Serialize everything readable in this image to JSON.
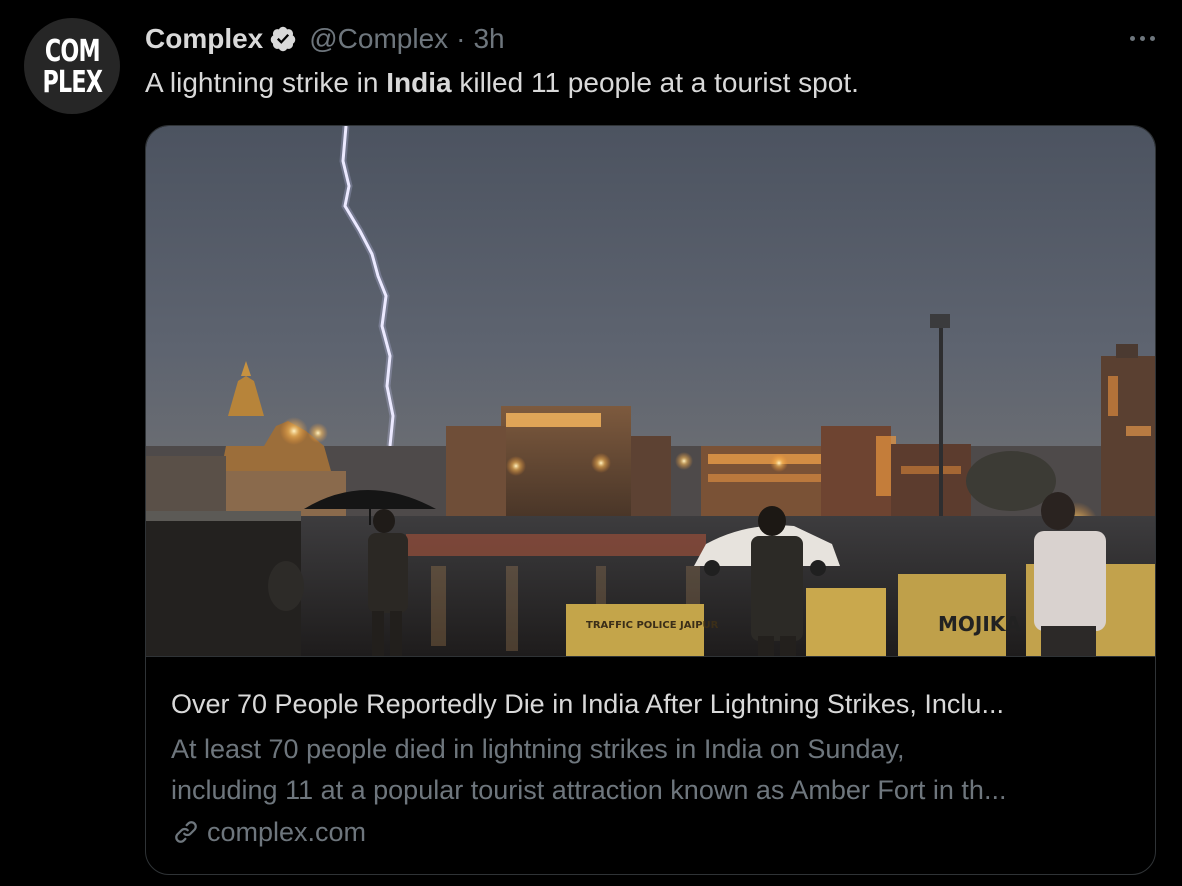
{
  "avatar": {
    "logo_line1": "COM",
    "logo_line2": "PLEX"
  },
  "author": {
    "display_name": "Complex",
    "handle": "@Complex",
    "separator": "·",
    "time": "3h"
  },
  "tweet": {
    "text_before": "A lightning strike in ",
    "text_bold": "India",
    "text_after": " killed 11 people at a tourist spot."
  },
  "card": {
    "title": "Over 70 People Reportedly Die in India After Lightning Strikes, Inclu...",
    "description_line1": "At least 70 people died in lightning strikes in India on Sunday,",
    "description_line2": "including 11 at a popular tourist attraction known as Amber Fort in th...",
    "domain": "complex.com",
    "image_signs": {
      "sign1": "TRAFFIC POLICE JAIPUR",
      "sign2": "MOJIKA"
    }
  },
  "icons": {
    "verified": "verified-badge-icon",
    "more": "more-horizontal-icon",
    "link": "link-icon"
  },
  "colors": {
    "background": "#000000",
    "text": "#d9d9d9",
    "secondary": "#6e767d",
    "border": "#2f3336"
  }
}
